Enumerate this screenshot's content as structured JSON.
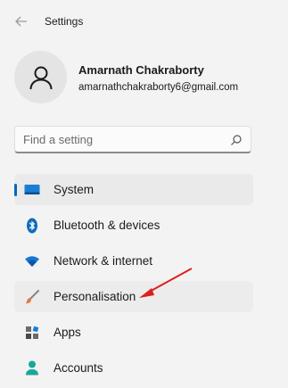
{
  "window": {
    "title": "Settings"
  },
  "profile": {
    "name": "Amarnath Chakraborty",
    "email": "amarnathchakraborty6@gmail.com"
  },
  "search": {
    "placeholder": "Find a setting"
  },
  "nav": {
    "items": [
      {
        "label": "System",
        "icon": "system-icon",
        "selected": true
      },
      {
        "label": "Bluetooth & devices",
        "icon": "bluetooth-icon"
      },
      {
        "label": "Network & internet",
        "icon": "wifi-icon"
      },
      {
        "label": "Personalisation",
        "icon": "brush-icon",
        "highlighted": true
      },
      {
        "label": "Apps",
        "icon": "apps-icon"
      },
      {
        "label": "Accounts",
        "icon": "accounts-icon"
      }
    ]
  },
  "colors": {
    "accent": "#0067c0",
    "annotation": "#e01e1e"
  }
}
